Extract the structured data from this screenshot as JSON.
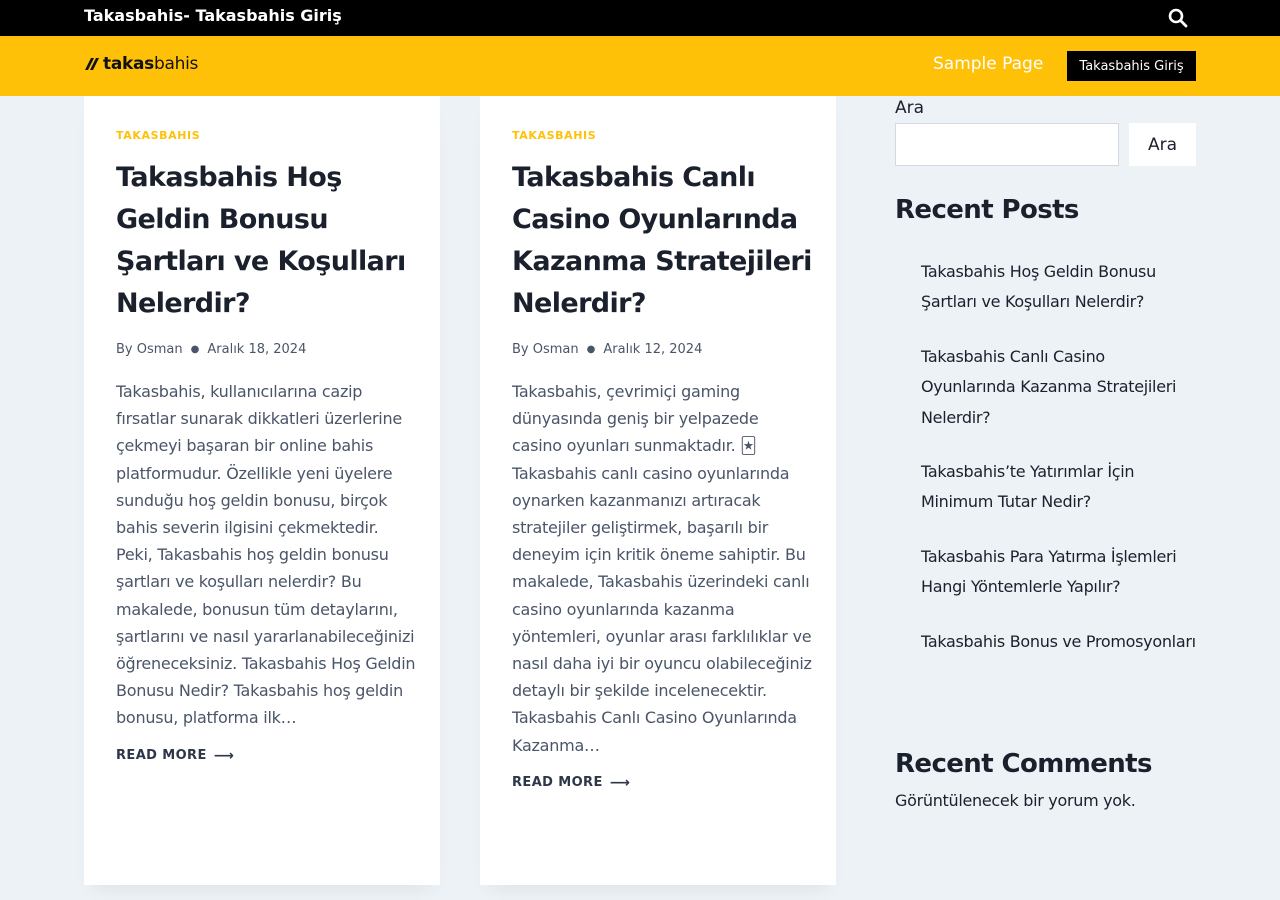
{
  "topbar": {
    "site_title": "Takasbahis- Takasbahis Giriş",
    "search_icon": "search-icon"
  },
  "header": {
    "logo_bold": "takas",
    "logo_light": "bahis",
    "nav": {
      "sample_page": "Sample Page",
      "cta": "Takasbahis Giriş"
    }
  },
  "posts": [
    {
      "category": "TAKASBAHIS",
      "title": "Takasbahis Hoş Geldin Bonusu Şartları ve Koşulları Nelerdir?",
      "by": "By",
      "author": "Osman",
      "date": "Aralık 18, 2024",
      "excerpt": "Takasbahis, kullanıcılarına cazip fırsatlar sunarak dikkatleri üzerlerine çekmeyi başaran bir online bahis platformudur. Özellikle yeni üyelere sunduğu hoş geldin bonusu, birçok bahis severin ilgisini çekmektedir. Peki, Takasbahis hoş geldin bonusu şartları ve koşulları nelerdir? Bu makalede, bonusun tüm detaylarını, şartlarını ve nasıl yararlanabileceğinizi öğreneceksiniz. Takasbahis Hoş Geldin Bonusu Nedir? Takasbahis hoş geldin bonusu, platforma ilk…",
      "read_more": "READ MORE"
    },
    {
      "category": "TAKASBAHIS",
      "title": "Takasbahis Canlı Casino Oyunlarında Kazanma Stratejileri Nelerdir?",
      "by": "By",
      "author": "Osman",
      "date": "Aralık 12, 2024",
      "excerpt": "Takasbahis, çevrimiçi gaming dünyasında geniş bir yelpazede casino oyunları sunmaktadır. 🃏 Takasbahis canlı casino oyunlarında oynarken kazanmanızı artıracak stratejiler geliştirmek, başarılı bir deneyim için kritik öneme sahiptir. Bu makalede, Takasbahis üzerindeki canlı casino oyunlarında kazanma yöntemleri, oyunlar arası farklılıklar ve nasıl daha iyi bir oyuncu olabileceğiniz detaylı bir şekilde incelenecektir. Takasbahis Canlı Casino Oyunlarında Kazanma…",
      "read_more": "READ MORE"
    }
  ],
  "sidebar": {
    "search_label": "Ara",
    "search_value": "",
    "search_button": "Ara",
    "recent_posts_title": "Recent Posts",
    "recent_posts": [
      "Takasbahis Hoş Geldin Bonusu Şartları ve Koşulları Nelerdir?",
      "Takasbahis Canlı Casino Oyunlarında Kazanma Stratejileri Nelerdir?",
      "Takasbahis’te Yatırımlar İçin Minimum Tutar Nedir?",
      "Takasbahis Para Yatırma İşlemleri Hangi Yöntemlerle Yapılır?",
      "Takasbahis Bonus ve Promosyonları"
    ],
    "recent_comments_title": "Recent Comments",
    "no_comments": "Görüntülenecek bir yorum yok."
  },
  "colors": {
    "accent": "#ffc107",
    "topbar": "#000000",
    "background": "#edf2f7"
  }
}
